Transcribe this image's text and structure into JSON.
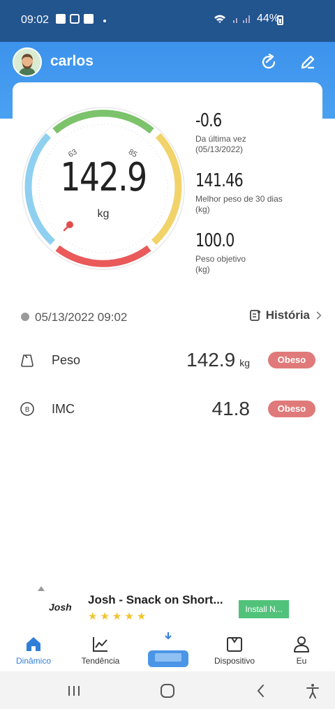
{
  "status_bar": {
    "time": "09:02",
    "battery": "44%"
  },
  "header": {
    "username": "carlos",
    "icons": [
      "refresh-icon",
      "edit-icon"
    ]
  },
  "gauge": {
    "value": "142.9",
    "unit": "kg",
    "tick_low": "63",
    "tick_high": "85",
    "colors": {
      "low": "#8fd0f0",
      "normal": "#7cc36c",
      "over": "#f1d36a",
      "obese": "#ea5a5a"
    }
  },
  "stats": [
    {
      "value": "-0.6",
      "label_line1": "Da última vez",
      "label_line2": "(05/13/2022)"
    },
    {
      "value": "141.46",
      "label_line1": "Melhor peso de 30 dias",
      "label_line2": "(kg)"
    },
    {
      "value": "100.0",
      "label_line1": "Peso objetivo",
      "label_line2": "(kg)"
    }
  ],
  "measurement": {
    "datetime": "05/13/2022 09:02",
    "history_label": "História"
  },
  "metrics": [
    {
      "name": "Peso",
      "value": "142.9",
      "unit": "kg",
      "badge": "Obeso",
      "icon": "weight-icon"
    },
    {
      "name": "IMC",
      "value": "41.8",
      "unit": "",
      "badge": "Obeso",
      "icon": "bmi-icon"
    }
  ],
  "ad": {
    "logo": "Josh",
    "title": "Josh - Snack on Short...",
    "rating_stars": 5,
    "install_label": "Install N..."
  },
  "bottom_nav": [
    {
      "label": "Dinâmico",
      "active": true,
      "icon": "home-icon"
    },
    {
      "label": "Tendência",
      "active": false,
      "icon": "trend-icon"
    },
    {
      "label": "Dispositivo",
      "active": false,
      "icon": "device-icon"
    },
    {
      "label": "Eu",
      "active": false,
      "icon": "person-icon"
    }
  ],
  "accent_color": "#3d93ec"
}
